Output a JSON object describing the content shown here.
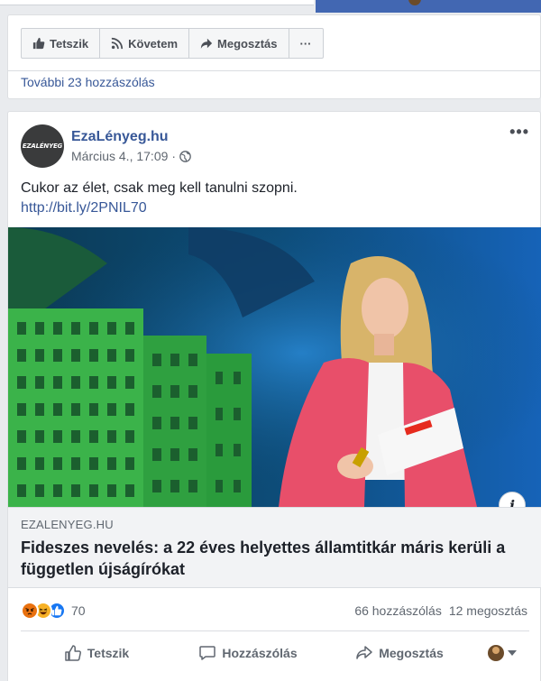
{
  "top_post": {
    "buttons": {
      "like": "Tetszik",
      "follow": "Követem",
      "share": "Megosztás",
      "more": "···"
    },
    "more_comments": "További 23 hozzászólás"
  },
  "post": {
    "page_name": "EzaLényeg.hu",
    "avatar_logo": "EZALÉNYEG",
    "timestamp": "Március 4., 17:09",
    "privacy_icon": "globe-icon",
    "menu": "•••",
    "text": "Cukor az élet, csak meg kell tanulni szopni.",
    "link": "http://bit.ly/2PNIL70",
    "info_label": "i",
    "link_preview": {
      "domain": "EZALENYEG.HU",
      "title": "Fideszes nevelés: a 22 éves helyettes államtitkár máris kerüli a független újságírókat"
    },
    "reactions": {
      "icons": [
        "angry-icon",
        "haha-icon",
        "like-icon"
      ],
      "count": "70",
      "comments": "66 hozzászólás",
      "shares": "12 megosztás"
    },
    "actions": {
      "like": "Tetszik",
      "comment": "Hozzászólás",
      "share": "Megosztás"
    }
  },
  "colors": {
    "facebook_blue": "#4267b2",
    "link_blue": "#385898",
    "background": "#e9ebee"
  }
}
